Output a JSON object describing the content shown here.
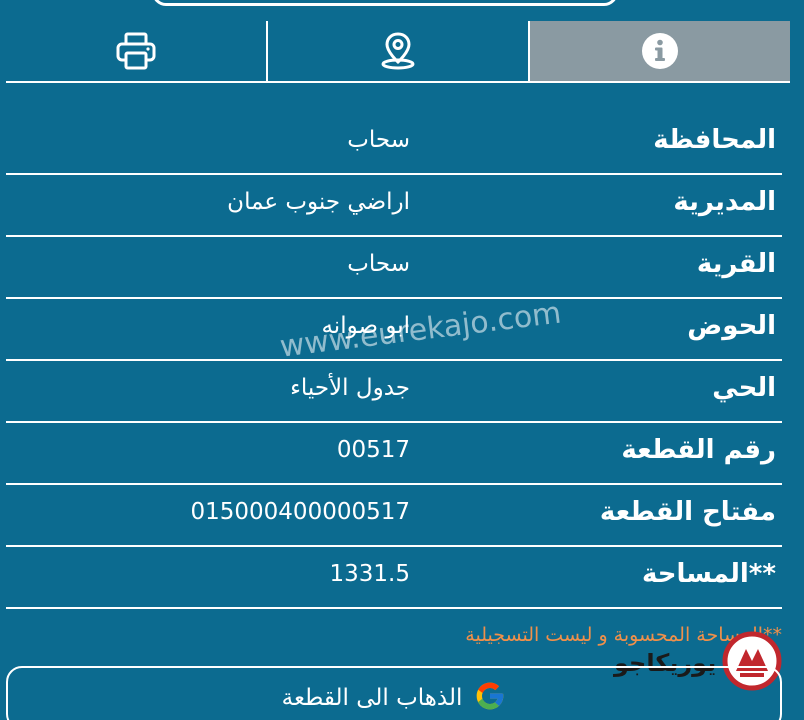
{
  "tabs": [
    {
      "icon": "printer-icon",
      "active": false
    },
    {
      "icon": "map-pin-icon",
      "active": false
    },
    {
      "icon": "info-icon",
      "active": true
    }
  ],
  "details": {
    "rows": [
      {
        "label": "المحافظة",
        "value": "سحاب"
      },
      {
        "label": "المديرية",
        "value": "اراضي جنوب عمان"
      },
      {
        "label": "القرية",
        "value": "سحاب"
      },
      {
        "label": "الحوض",
        "value": "ابو صوانه"
      },
      {
        "label": "الحي",
        "value": "جدول الأحياء"
      },
      {
        "label": "رقم القطعة",
        "value": "00517"
      },
      {
        "label": "مفتاح القطعة",
        "value": "015000400000517"
      },
      {
        "label": "**المساحة",
        "value": "1331.5"
      }
    ]
  },
  "watermark": "www.eurekajo.com",
  "note": "**المساحة المحسوبة و ليست التسجيلية",
  "logo": {
    "text": "يوريكاجو",
    "icon": "eurekajo-logo-icon"
  },
  "go_button": {
    "label": "الذهاب الى القطعة",
    "icon": "google-icon"
  },
  "colors": {
    "background": "#0c6b90",
    "active_tab": "#8a9aa2",
    "note": "#f0904a"
  }
}
